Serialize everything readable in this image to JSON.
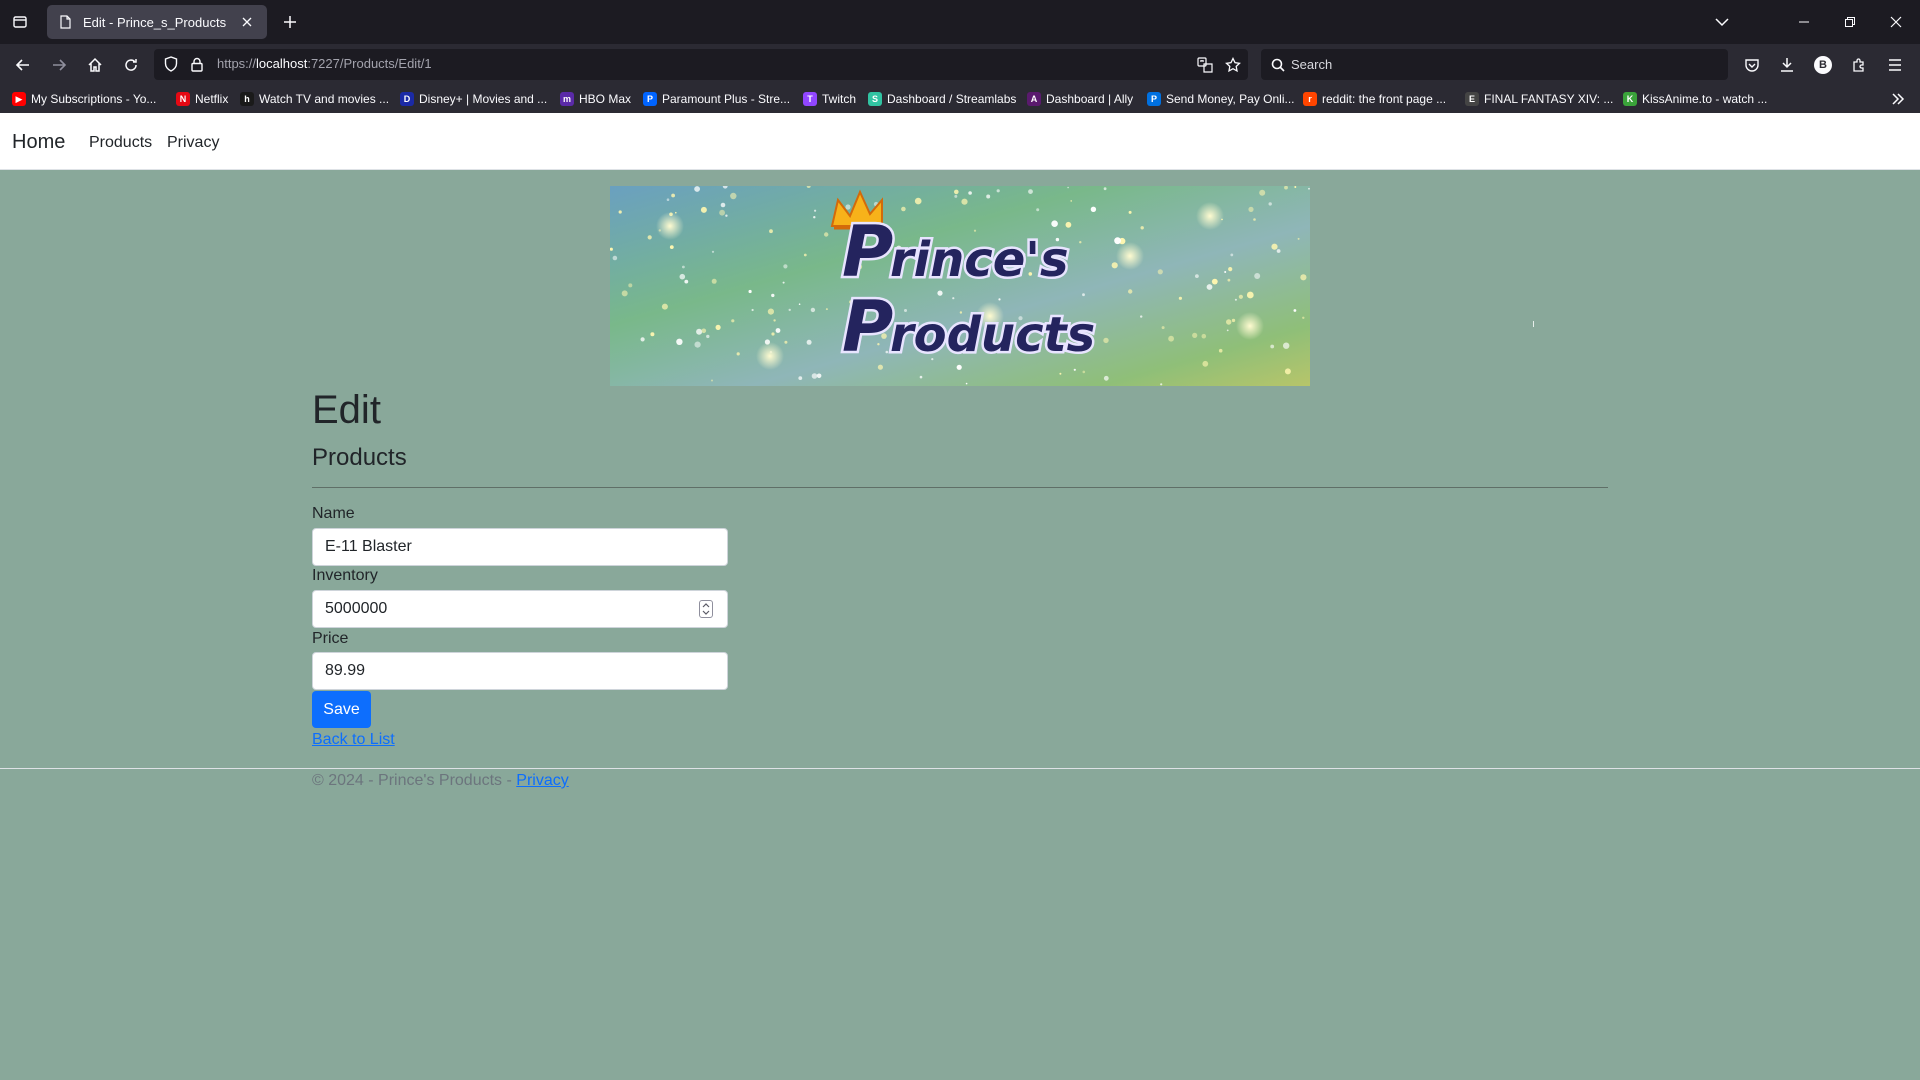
{
  "browser": {
    "tab": {
      "title": "Edit - Prince_s_Products",
      "favicon": "page-icon"
    },
    "address": {
      "prefix": "https://",
      "host": "localhost",
      "path": ":7227/Products/Edit/1"
    },
    "search": {
      "placeholder": "Search"
    },
    "profile_initial": "B",
    "bookmarks": [
      {
        "label": "My Subscriptions - Yo...",
        "icon": "youtube-icon",
        "color": "#ff0000",
        "glyph": "▶"
      },
      {
        "label": "Netflix",
        "icon": "netflix-icon",
        "color": "#e50914",
        "glyph": "N"
      },
      {
        "label": "Watch TV and movies ...",
        "icon": "hulu-icon",
        "color": "#1a1a1a",
        "glyph": "h"
      },
      {
        "label": "Disney+ | Movies and ...",
        "icon": "disney-icon",
        "color": "#1b2aa6",
        "glyph": "D"
      },
      {
        "label": "HBO Max",
        "icon": "hbo-icon",
        "color": "#5a2aa8",
        "glyph": "m"
      },
      {
        "label": "Paramount Plus - Stre...",
        "icon": "paramount-icon",
        "color": "#0064ff",
        "glyph": "P"
      },
      {
        "label": "Twitch",
        "icon": "twitch-icon",
        "color": "#9146ff",
        "glyph": "T"
      },
      {
        "label": "Dashboard / Streamlabs",
        "icon": "streamlabs-icon",
        "color": "#31c3a2",
        "glyph": "S"
      },
      {
        "label": "Dashboard | Ally",
        "icon": "ally-icon",
        "color": "#5a1a6e",
        "glyph": "A"
      },
      {
        "label": "Send Money, Pay Onli...",
        "icon": "paypal-icon",
        "color": "#0070e0",
        "glyph": "P"
      },
      {
        "label": "reddit: the front page ...",
        "icon": "reddit-icon",
        "color": "#ff4500",
        "glyph": "r"
      },
      {
        "label": "FINAL FANTASY XIV: ...",
        "icon": "ffxiv-icon",
        "color": "#444444",
        "glyph": "E"
      },
      {
        "label": "KissAnime.to - watch ...",
        "icon": "kissanime-icon",
        "color": "#3aa33a",
        "glyph": "K"
      }
    ]
  },
  "site": {
    "brand": "Home",
    "nav": [
      "Products",
      "Privacy"
    ],
    "banner": {
      "line1": "Prince's",
      "line2": "Products"
    }
  },
  "page": {
    "title": "Edit",
    "subtitle": "Products",
    "fields": {
      "name": {
        "label": "Name",
        "value": "E-11 Blaster"
      },
      "inventory": {
        "label": "Inventory",
        "value": "5000000"
      },
      "price": {
        "label": "Price",
        "value": "89.99"
      }
    },
    "save_label": "Save",
    "back_label": "Back to List"
  },
  "footer": {
    "text": "© 2024 - Prince's Products - ",
    "link": "Privacy"
  }
}
